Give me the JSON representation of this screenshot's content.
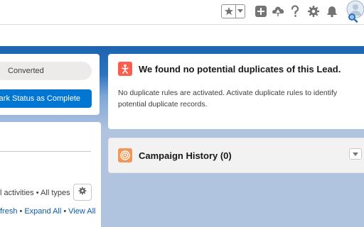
{
  "header": {
    "icons": [
      "favorites-star-icon",
      "favorites-dropdown-icon",
      "global-actions-icon",
      "trailhead-icon",
      "help-icon",
      "setup-gear-icon",
      "notifications-bell-icon",
      "user-avatar-icon"
    ]
  },
  "path": {
    "status_value": "Converted",
    "complete_button_label": "Mark Status as Complete"
  },
  "activity": {
    "filters_label": "l activities • All types",
    "links": {
      "refresh": "fresh",
      "expand_all": "Expand All",
      "view_all": "View All",
      "separator": "•"
    }
  },
  "duplicates": {
    "icon": "duplicate-lead-icon",
    "title": "We found no potential duplicates of this Lead.",
    "message": "No duplicate rules are activated. Activate duplicate rules to identify potential duplicate records."
  },
  "campaign_history": {
    "icon": "campaign-target-icon",
    "title": "Campaign History (0)"
  },
  "colors": {
    "brand_blue": "#0176d3",
    "duplicate_icon": "#fe5c4c",
    "campaign_icon": "#f49756",
    "link": "#0b5cab"
  }
}
